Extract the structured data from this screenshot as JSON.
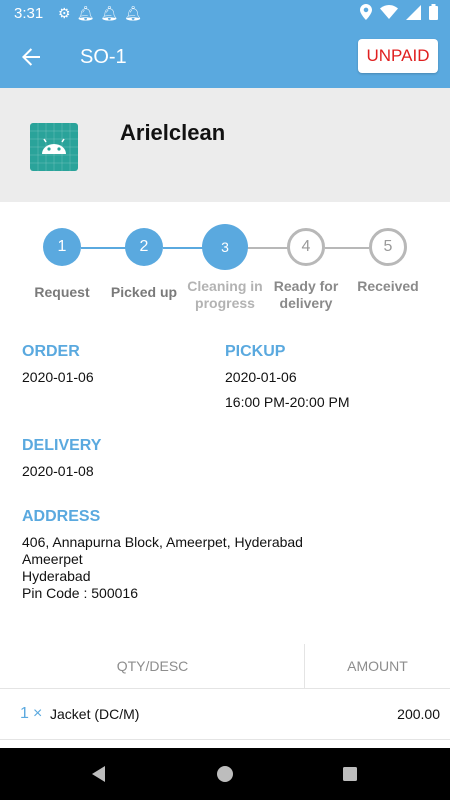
{
  "status_bar": {
    "time": "3:31",
    "icons_left": [
      "gear-icon",
      "bell-icon",
      "bell-icon",
      "bell-icon"
    ],
    "icons_right": [
      "location-icon",
      "wifi-icon",
      "signal-icon",
      "battery-icon"
    ]
  },
  "app_bar": {
    "title": "SO-1",
    "payment_status": "UNPAID"
  },
  "shop": {
    "name": "Arielclean",
    "logo_icon": "android-icon"
  },
  "steps": [
    {
      "number": "1",
      "label": "Request",
      "state": "done"
    },
    {
      "number": "2",
      "label": "Picked up",
      "state": "done"
    },
    {
      "number": "3",
      "label": "Cleaning in progress",
      "state": "current"
    },
    {
      "number": "4",
      "label": "Ready for delivery",
      "state": "todo"
    },
    {
      "number": "5",
      "label": "Received",
      "state": "todo"
    }
  ],
  "order": {
    "label": "ORDER",
    "date": "2020-01-06"
  },
  "pickup": {
    "label": "PICKUP",
    "date": "2020-01-06",
    "time": "16:00 PM-20:00 PM"
  },
  "delivery": {
    "label": "DELIVERY",
    "date": "2020-01-08"
  },
  "address": {
    "label": "ADDRESS",
    "line1": "406, Annapurna Block, Ameerpet, Hyderabad",
    "line2": "Ameerpet",
    "line3": "Hyderabad",
    "line4": "Pin Code : 500016"
  },
  "table": {
    "headers": {
      "qty_desc": "QTY/DESC",
      "amount": "AMOUNT"
    },
    "rows": [
      {
        "qty": "1",
        "times": "×",
        "desc": "Jacket (DC/M)",
        "amount": "200.00"
      }
    ]
  },
  "colors": {
    "accent": "#5aa9df",
    "unpaid": "#e02020",
    "header_bg": "#ececec"
  }
}
